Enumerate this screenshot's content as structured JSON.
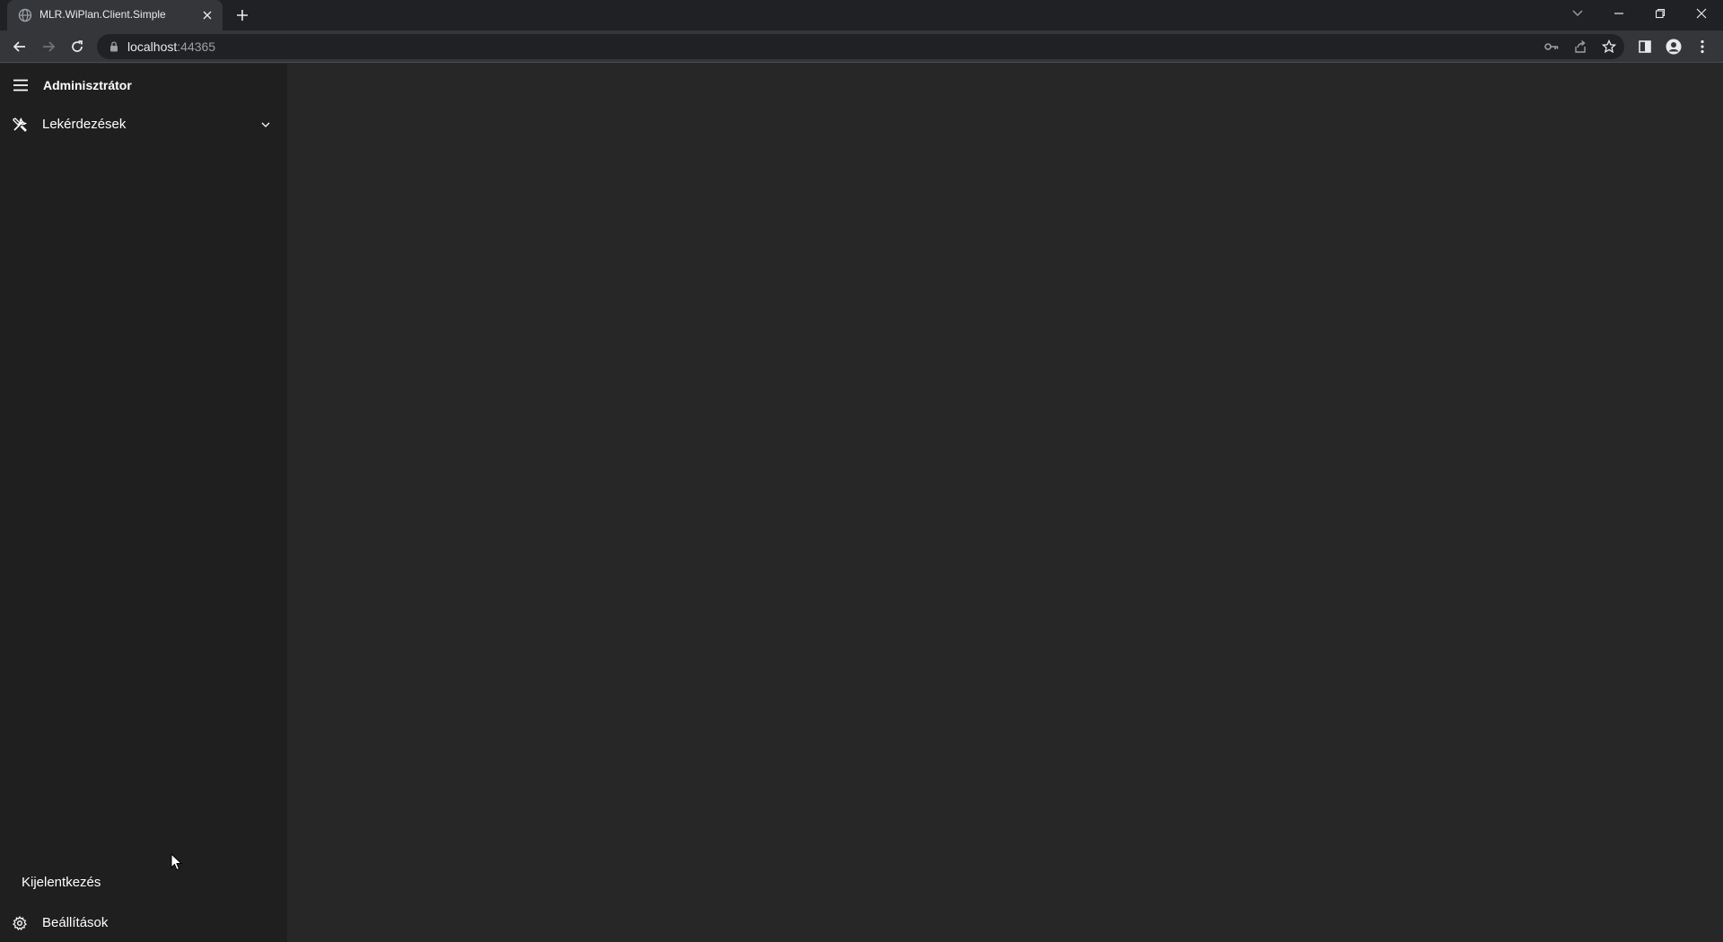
{
  "browser": {
    "tab": {
      "title": "MLR.WiPlan.Client.Simple",
      "favicon": "globe-icon"
    },
    "address_bar": {
      "host": "localhost",
      "port": ":44365"
    }
  },
  "app": {
    "sidebar": {
      "title": "Adminisztrátor",
      "nav": [
        {
          "label": "Lekérdezések",
          "icon": "tools-icon"
        }
      ],
      "logout_label": "Kijelentkezés",
      "settings_label": "Beállítások"
    }
  },
  "colors": {
    "chrome_bg": "#202124",
    "toolbar_bg": "#35363a",
    "sidebar_bg": "#1f1f1f",
    "content_bg": "#272727",
    "text": "#ffffff"
  }
}
